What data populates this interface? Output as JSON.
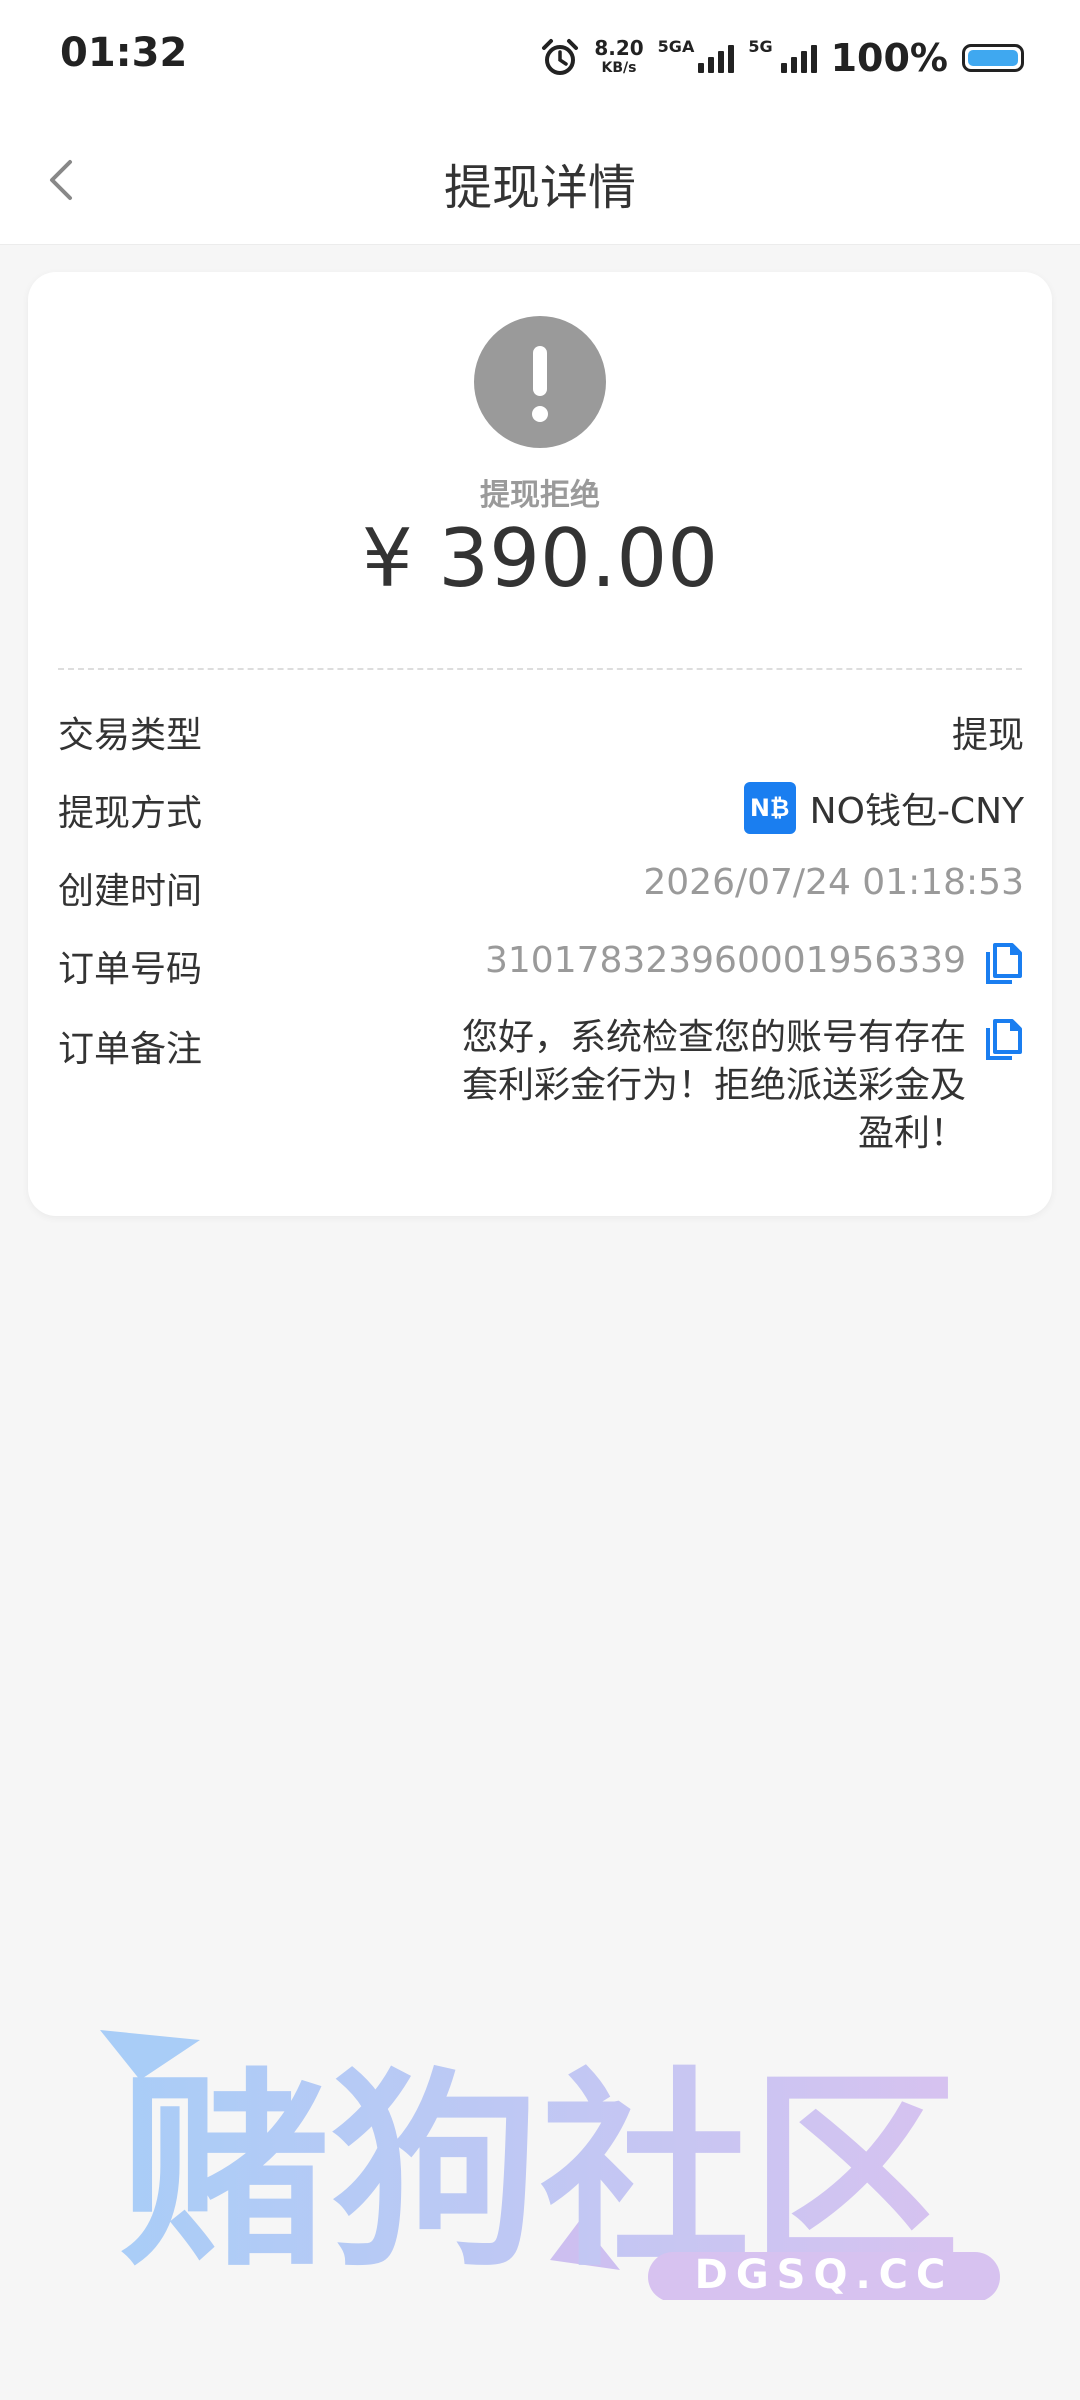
{
  "status_bar": {
    "time": "01:32",
    "net_speed_value": "8.20",
    "net_speed_unit": "KB/s",
    "sim1_label": "5GA",
    "sim2_label": "5G",
    "battery": "100%",
    "alarm_icon": "alarm-clock-icon"
  },
  "header": {
    "title": "提现详情",
    "back_icon": "chevron-left-icon"
  },
  "summary": {
    "status": "提现拒绝",
    "amount": "¥ 390.00",
    "status_icon": "exclamation-icon"
  },
  "details": {
    "type_label": "交易类型",
    "type_value": "提现",
    "method_label": "提现方式",
    "method_logo": "N₿",
    "method_value": "NO钱包-CNY",
    "created_label": "创建时间",
    "created_value": "2026/07/24 01:18:53",
    "order_label": "订单号码",
    "order_value": "310178323960001956339",
    "note_label": "订单备注",
    "note_value": "您好，系统检查您的账号有存在套利彩金行为！拒绝派送彩金及盈利！"
  },
  "watermark": {
    "title": "赌狗社区",
    "domain": "DGSQ.CC"
  },
  "colors": {
    "accent_blue": "#1a7ef0",
    "status_gray": "#9a9a9a"
  }
}
